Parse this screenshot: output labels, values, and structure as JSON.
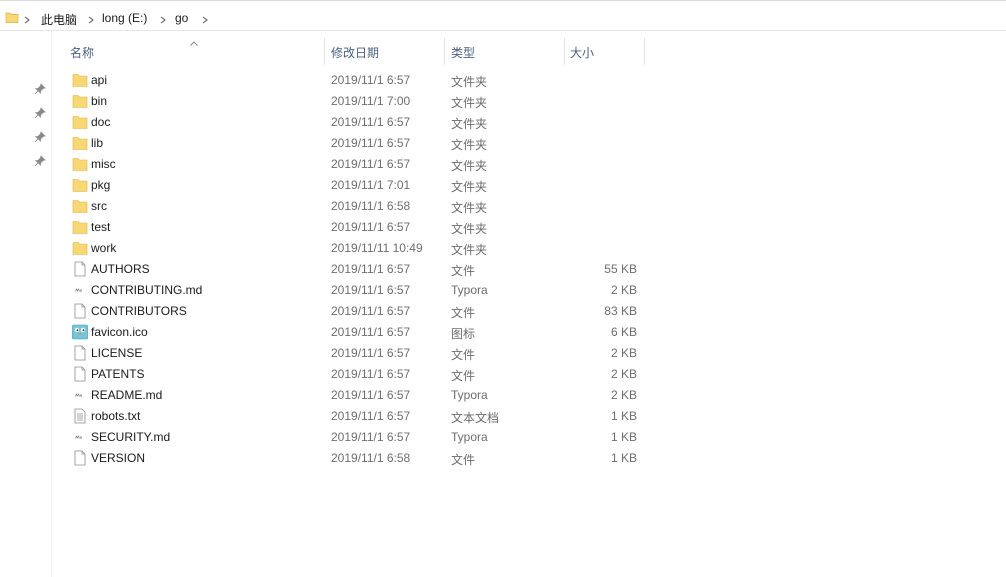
{
  "breadcrumb": {
    "items": [
      "此电脑",
      "long (E:)",
      "go"
    ]
  },
  "columns": {
    "name": "名称",
    "date": "修改日期",
    "type": "类型",
    "size": "大小"
  },
  "files": [
    {
      "name": "api",
      "date": "2019/11/1 6:57",
      "type": "文件夹",
      "size": "",
      "icon": "folder-icon"
    },
    {
      "name": "bin",
      "date": "2019/11/1 7:00",
      "type": "文件夹",
      "size": "",
      "icon": "folder-icon"
    },
    {
      "name": "doc",
      "date": "2019/11/1 6:57",
      "type": "文件夹",
      "size": "",
      "icon": "folder-icon"
    },
    {
      "name": "lib",
      "date": "2019/11/1 6:57",
      "type": "文件夹",
      "size": "",
      "icon": "folder-icon"
    },
    {
      "name": "misc",
      "date": "2019/11/1 6:57",
      "type": "文件夹",
      "size": "",
      "icon": "folder-icon"
    },
    {
      "name": "pkg",
      "date": "2019/11/1 7:01",
      "type": "文件夹",
      "size": "",
      "icon": "folder-icon"
    },
    {
      "name": "src",
      "date": "2019/11/1 6:58",
      "type": "文件夹",
      "size": "",
      "icon": "folder-icon"
    },
    {
      "name": "test",
      "date": "2019/11/1 6:57",
      "type": "文件夹",
      "size": "",
      "icon": "folder-icon"
    },
    {
      "name": "work",
      "date": "2019/11/11 10:49",
      "type": "文件夹",
      "size": "",
      "icon": "folder-icon"
    },
    {
      "name": "AUTHORS",
      "date": "2019/11/1 6:57",
      "type": "文件",
      "size": "55 KB",
      "icon": "file-icon"
    },
    {
      "name": "CONTRIBUTING.md",
      "date": "2019/11/1 6:57",
      "type": "Typora",
      "size": "2 KB",
      "icon": "markdown-file-icon"
    },
    {
      "name": "CONTRIBUTORS",
      "date": "2019/11/1 6:57",
      "type": "文件",
      "size": "83 KB",
      "icon": "file-icon"
    },
    {
      "name": "favicon.ico",
      "date": "2019/11/1 6:57",
      "type": "图标",
      "size": "6 KB",
      "icon": "gopher-icon"
    },
    {
      "name": "LICENSE",
      "date": "2019/11/1 6:57",
      "type": "文件",
      "size": "2 KB",
      "icon": "file-icon"
    },
    {
      "name": "PATENTS",
      "date": "2019/11/1 6:57",
      "type": "文件",
      "size": "2 KB",
      "icon": "file-icon"
    },
    {
      "name": "README.md",
      "date": "2019/11/1 6:57",
      "type": "Typora",
      "size": "2 KB",
      "icon": "markdown-file-icon"
    },
    {
      "name": "robots.txt",
      "date": "2019/11/1 6:57",
      "type": "文本文档",
      "size": "1 KB",
      "icon": "text-file-icon"
    },
    {
      "name": "SECURITY.md",
      "date": "2019/11/1 6:57",
      "type": "Typora",
      "size": "1 KB",
      "icon": "markdown-file-icon"
    },
    {
      "name": "VERSION",
      "date": "2019/11/1 6:58",
      "type": "文件",
      "size": "1 KB",
      "icon": "file-icon"
    }
  ],
  "colors": {
    "folder": "#f8d775",
    "header_text": "#4d6082",
    "secondary_text": "#6d6d6d"
  }
}
